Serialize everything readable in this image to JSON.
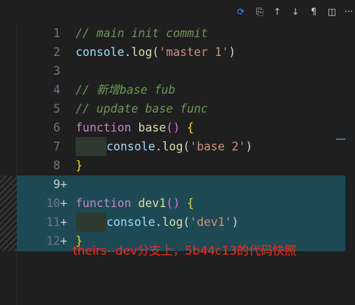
{
  "toolbar": {
    "icons": [
      "source-control-sync-icon",
      "open-file-icon",
      "arrow-up-icon",
      "arrow-down-icon",
      "pilcrow-icon",
      "split-editor-icon",
      "more-icon"
    ],
    "glyphs": [
      "⟳",
      "⎘",
      "↑",
      "↓",
      "¶",
      "◫",
      "···"
    ]
  },
  "lines": [
    {
      "num": "1",
      "plus": "",
      "c": [
        "// main init commit"
      ]
    },
    {
      "num": "2",
      "plus": "",
      "c": [
        "console",
        ".",
        "log",
        "(",
        "'master 1'",
        ")"
      ]
    },
    {
      "num": "3",
      "plus": "",
      "c": []
    },
    {
      "num": "4",
      "plus": "",
      "c": [
        "// 新增base fub"
      ]
    },
    {
      "num": "5",
      "plus": "",
      "c": [
        "// update base func"
      ]
    },
    {
      "num": "6",
      "plus": "",
      "c": [
        "function",
        " ",
        "base",
        "()",
        " ",
        "{"
      ]
    },
    {
      "num": "7",
      "plus": "",
      "c": [
        "console",
        ".",
        "log",
        "(",
        "'base 2'",
        ")"
      ]
    },
    {
      "num": "8",
      "plus": "",
      "c": [
        "}"
      ]
    },
    {
      "num": "9",
      "plus": "+",
      "c": []
    },
    {
      "num": "10",
      "plus": "+",
      "c": [
        "function",
        " ",
        "dev1",
        "()",
        " ",
        "{"
      ]
    },
    {
      "num": "11",
      "plus": "+",
      "c": [
        "console",
        ".",
        "log",
        "(",
        "'dev1'",
        ")"
      ]
    },
    {
      "num": "12",
      "plus": "+",
      "c": [
        "}"
      ]
    }
  ],
  "annotation": "theirs--dev分支上，5b44c13的代码快照"
}
